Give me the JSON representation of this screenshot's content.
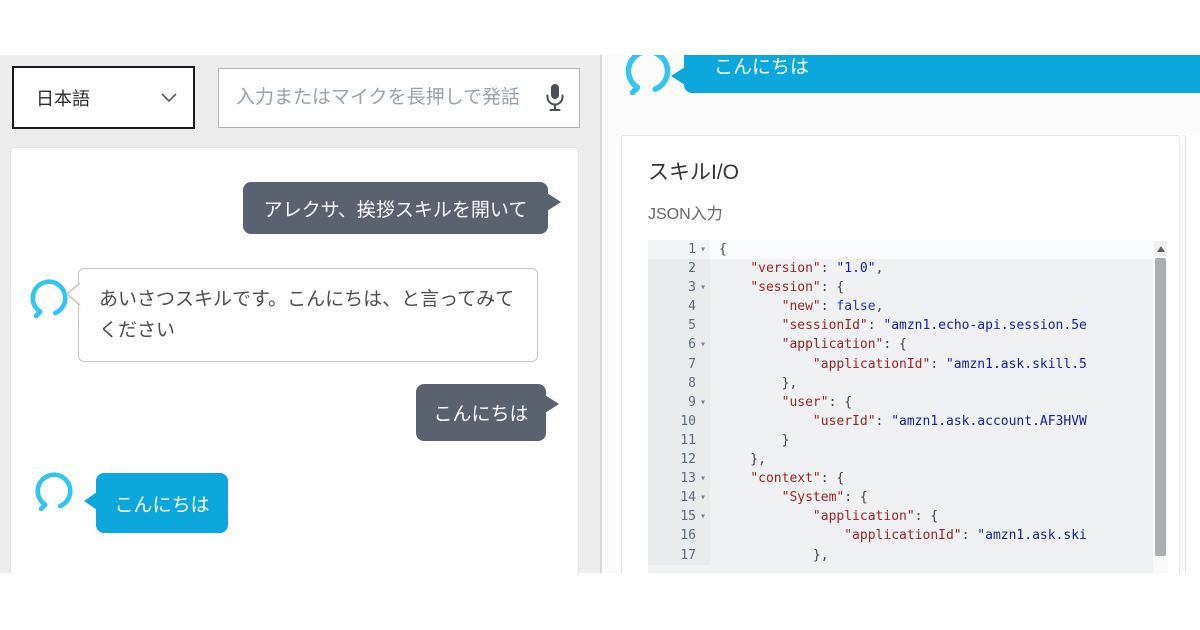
{
  "colors": {
    "alexa_blue": "#0ca7dc",
    "alexa_ring_cyan": "#31c5f1",
    "user_bubble_gray": "#5a6270",
    "json_key": "#9b2323",
    "json_string": "#1321a7",
    "json_bool": "#2433de"
  },
  "left_panel": {
    "language_selector": {
      "value": "日本語"
    },
    "input": {
      "placeholder": "入力またはマイクを長押しで発話"
    },
    "chat": {
      "messages": [
        {
          "role": "user",
          "text": "アレクサ、挨拶スキルを開いて"
        },
        {
          "role": "alexa",
          "text": "あいさつスキルです。こんにちは、と言ってみてください"
        },
        {
          "role": "user",
          "text": "こんにちは"
        },
        {
          "role": "alexa",
          "text": "こんにちは"
        }
      ]
    }
  },
  "right_panel": {
    "partial_message": {
      "role": "alexa",
      "text": "こんにちは"
    },
    "skill_io": {
      "title": "スキルI/O",
      "subtitle": "JSON入力",
      "editor": {
        "lines": [
          {
            "n": 1,
            "fold": true,
            "active": true,
            "tokens": [
              {
                "c": "p",
                "t": "{"
              }
            ]
          },
          {
            "n": 2,
            "tokens": [
              {
                "c": "p",
                "t": "    "
              },
              {
                "c": "k",
                "t": "\"version\""
              },
              {
                "c": "p",
                "t": ": "
              },
              {
                "c": "s",
                "t": "\"1.0\""
              },
              {
                "c": "p",
                "t": ","
              }
            ]
          },
          {
            "n": 3,
            "fold": true,
            "tokens": [
              {
                "c": "p",
                "t": "    "
              },
              {
                "c": "k",
                "t": "\"session\""
              },
              {
                "c": "p",
                "t": ": {"
              }
            ]
          },
          {
            "n": 4,
            "tokens": [
              {
                "c": "p",
                "t": "        "
              },
              {
                "c": "k",
                "t": "\"new\""
              },
              {
                "c": "p",
                "t": ": "
              },
              {
                "c": "b",
                "t": "false"
              },
              {
                "c": "p",
                "t": ","
              }
            ]
          },
          {
            "n": 5,
            "tokens": [
              {
                "c": "p",
                "t": "        "
              },
              {
                "c": "k",
                "t": "\"sessionId\""
              },
              {
                "c": "p",
                "t": ": "
              },
              {
                "c": "s",
                "t": "\"amzn1.echo-api.session.5e"
              }
            ]
          },
          {
            "n": 6,
            "fold": true,
            "tokens": [
              {
                "c": "p",
                "t": "        "
              },
              {
                "c": "k",
                "t": "\"application\""
              },
              {
                "c": "p",
                "t": ": {"
              }
            ]
          },
          {
            "n": 7,
            "tokens": [
              {
                "c": "p",
                "t": "            "
              },
              {
                "c": "k",
                "t": "\"applicationId\""
              },
              {
                "c": "p",
                "t": ": "
              },
              {
                "c": "s",
                "t": "\"amzn1.ask.skill.5"
              }
            ]
          },
          {
            "n": 8,
            "tokens": [
              {
                "c": "p",
                "t": "        },"
              }
            ]
          },
          {
            "n": 9,
            "fold": true,
            "tokens": [
              {
                "c": "p",
                "t": "        "
              },
              {
                "c": "k",
                "t": "\"user\""
              },
              {
                "c": "p",
                "t": ": {"
              }
            ]
          },
          {
            "n": 10,
            "tokens": [
              {
                "c": "p",
                "t": "            "
              },
              {
                "c": "k",
                "t": "\"userId\""
              },
              {
                "c": "p",
                "t": ": "
              },
              {
                "c": "s",
                "t": "\"amzn1.ask.account.AF3HVW"
              }
            ]
          },
          {
            "n": 11,
            "tokens": [
              {
                "c": "p",
                "t": "        }"
              }
            ]
          },
          {
            "n": 12,
            "tokens": [
              {
                "c": "p",
                "t": "    },"
              }
            ]
          },
          {
            "n": 13,
            "fold": true,
            "tokens": [
              {
                "c": "p",
                "t": "    "
              },
              {
                "c": "k",
                "t": "\"context\""
              },
              {
                "c": "p",
                "t": ": {"
              }
            ]
          },
          {
            "n": 14,
            "fold": true,
            "tokens": [
              {
                "c": "p",
                "t": "        "
              },
              {
                "c": "k",
                "t": "\"System\""
              },
              {
                "c": "p",
                "t": ": {"
              }
            ]
          },
          {
            "n": 15,
            "fold": true,
            "tokens": [
              {
                "c": "p",
                "t": "            "
              },
              {
                "c": "k",
                "t": "\"application\""
              },
              {
                "c": "p",
                "t": ": {"
              }
            ]
          },
          {
            "n": 16,
            "tokens": [
              {
                "c": "p",
                "t": "                "
              },
              {
                "c": "k",
                "t": "\"applicationId\""
              },
              {
                "c": "p",
                "t": ": "
              },
              {
                "c": "s",
                "t": "\"amzn1.ask.ski"
              }
            ]
          },
          {
            "n": 17,
            "tokens": [
              {
                "c": "p",
                "t": "            },"
              }
            ]
          }
        ]
      }
    }
  }
}
